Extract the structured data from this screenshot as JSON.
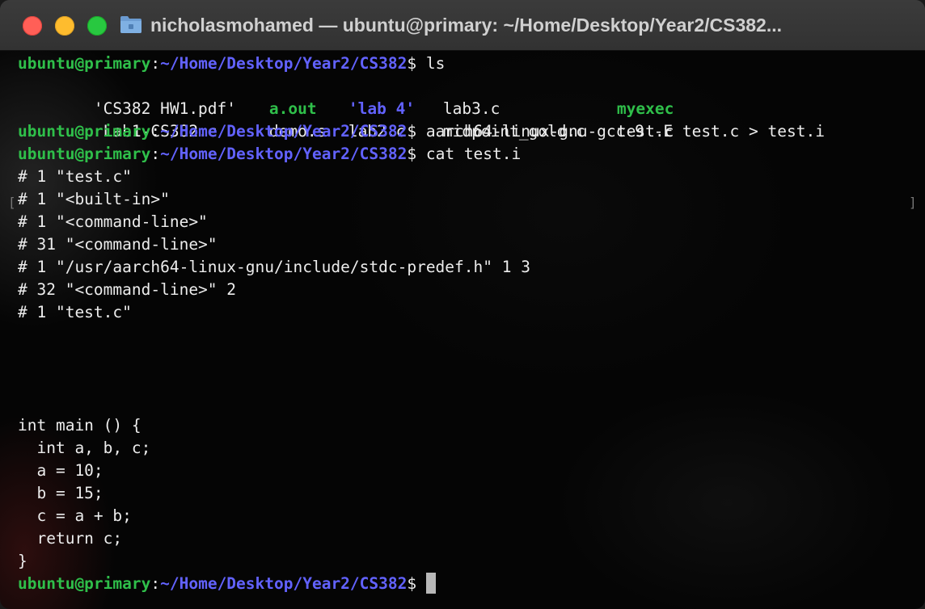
{
  "window": {
    "title": "nicholasmohamed — ubuntu@primary: ~/Home/Desktop/Year2/CS382...",
    "folder_icon": "folder-icon"
  },
  "prompt": {
    "user": "ubuntu@primary",
    "colon": ":",
    "path": "~/Home/Desktop/Year2/CS382",
    "dollar": "$ "
  },
  "commands": {
    "ls": "ls",
    "gcc": "aarch64-linux-gnu-gcc-9 -E test.c > test.i",
    "cat": "cat test.i"
  },
  "ls_output": {
    "row1": [
      {
        "text": "'CS382 HW1.pdf'",
        "type": "file"
      },
      {
        "text": "a.out",
        "type": "exe"
      },
      {
        "text": "'lab 4'",
        "type": "dir"
      },
      {
        "text": "lab3.c",
        "type": "file"
      },
      {
        "text": "myexec",
        "type": "exe"
      }
    ],
    "row2": [
      {
        "text": " Lab1-CS382.c",
        "type": "file"
      },
      {
        "text": "demo.s",
        "type": "file"
      },
      {
        "text": "lab2.c",
        "type": "file"
      },
      {
        "text": "midpoint_gold.c",
        "type": "file"
      },
      {
        "text": "test.c",
        "type": "file"
      }
    ]
  },
  "cat_output": [
    "# 1 \"test.c\"",
    "# 1 \"<built-in>\"",
    "# 1 \"<command-line>\"",
    "# 31 \"<command-line>\"",
    "# 1 \"/usr/aarch64-linux-gnu/include/stdc-predef.h\" 1 3",
    "# 32 \"<command-line>\" 2",
    "# 1 \"test.c\"",
    "",
    "",
    "",
    "",
    "int main () {",
    "  int a, b, c;",
    "  a = 10;",
    "  b = 15;",
    "  c = a + b;",
    "  return c;",
    "}"
  ],
  "colors": {
    "user": "#2fbf4a",
    "path": "#6262ff",
    "text": "#ececec",
    "background": "#050505"
  }
}
